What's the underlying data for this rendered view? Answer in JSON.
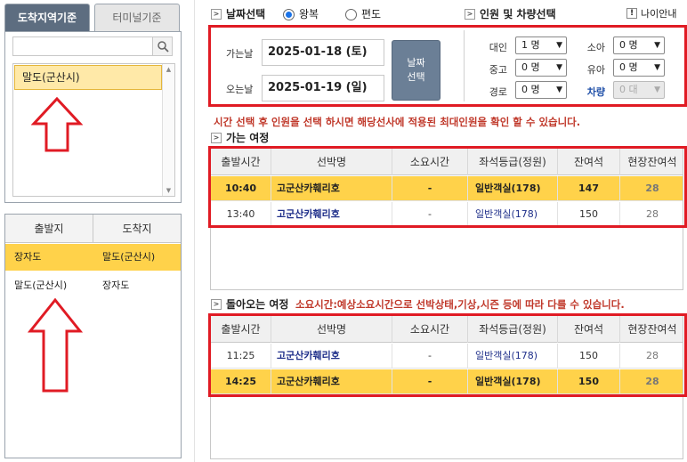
{
  "left_tabs": {
    "active": "도착지역기준",
    "inactive": "터미널기준"
  },
  "search": {
    "placeholder": "",
    "value": ""
  },
  "region_list": {
    "selected": "말도(군산시)"
  },
  "route_table": {
    "headers": [
      "출발지",
      "도착지"
    ],
    "rows": [
      {
        "from": "장자도",
        "to": "말도(군산시)",
        "selected": true
      },
      {
        "from": "말도(군산시)",
        "to": "장자도",
        "selected": false
      }
    ]
  },
  "date_section": {
    "title": "날짜선택",
    "trip_round": "왕복",
    "trip_oneway": "편도",
    "depart_label": "가는날",
    "depart_value": "2025-01-18 (토)",
    "return_label": "오는날",
    "return_value": "2025-01-19 (일)",
    "select_button_line1": "날짜",
    "select_button_line2": "선택"
  },
  "pax_section": {
    "title": "인원 및 차량선택",
    "age_guide": "나이안내",
    "adult_label": "대인",
    "adult_value": "1 명",
    "child_label": "소아",
    "child_value": "0 명",
    "youth_label": "중고",
    "youth_value": "0 명",
    "infant_label": "유아",
    "infant_value": "0 명",
    "senior_label": "경로",
    "senior_value": "0 명",
    "vehicle_label": "차량",
    "vehicle_value": "0 대"
  },
  "notice_main": "시간 선택 후 인원을 선택 하시면 해당선사에 적용된 최대인원을 확인 할 수 있습니다.",
  "outbound": {
    "title": "가는 여정",
    "headers": [
      "출발시간",
      "선박명",
      "소요시간",
      "좌석등급(정원)",
      "잔여석",
      "현장잔여석"
    ],
    "rows": [
      {
        "time": "10:40",
        "ship": "고군산카훼리호",
        "duration": "-",
        "class": "일반객실(178)",
        "remaining": "147",
        "onsite": "28",
        "selected": true
      },
      {
        "time": "13:40",
        "ship": "고군산카훼리호",
        "duration": "-",
        "class": "일반객실(178)",
        "remaining": "150",
        "onsite": "28",
        "selected": false
      }
    ]
  },
  "inbound": {
    "title": "돌아오는 여정",
    "note": "소요시간:예상소요시간으로 선박상태,기상,시즌 등에 따라 다를 수 있습니다.",
    "headers": [
      "출발시간",
      "선박명",
      "소요시간",
      "좌석등급(정원)",
      "잔여석",
      "현장잔여석"
    ],
    "rows": [
      {
        "time": "11:25",
        "ship": "고군산카훼리호",
        "duration": "-",
        "class": "일반객실(178)",
        "remaining": "150",
        "onsite": "28",
        "selected": false
      },
      {
        "time": "14:25",
        "ship": "고군산카훼리호",
        "duration": "-",
        "class": "일반객실(178)",
        "remaining": "150",
        "onsite": "28",
        "selected": true
      }
    ]
  },
  "colors": {
    "highlight": "#ffd24a",
    "red_outline": "#e01b24",
    "tab_active": "#5d6d80",
    "ship_text": "#1f2f8a"
  }
}
